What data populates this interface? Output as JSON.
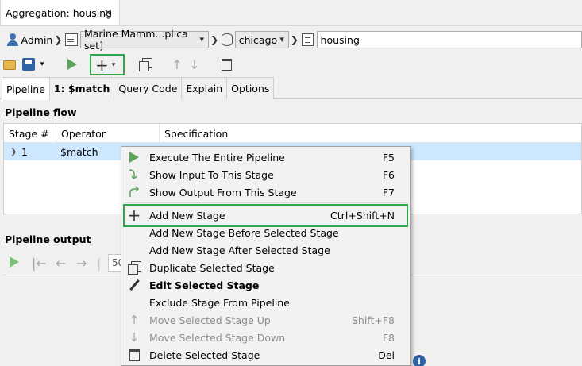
{
  "window": {
    "tab_title": "Aggregation: housing",
    "tab_close": "✕"
  },
  "breadcrumb": {
    "user": "Admin",
    "connection": "Marine Mamm...plica set]",
    "database": "chicago",
    "collection": "housing",
    "separator": "❯"
  },
  "toolbar": {
    "add_caret": "▾",
    "up_arrow": "↑",
    "down_arrow": "↓"
  },
  "tabs": [
    {
      "label": "Pipeline"
    },
    {
      "label": "1: $match"
    },
    {
      "label": "Query Code"
    },
    {
      "label": "Explain"
    },
    {
      "label": "Options"
    }
  ],
  "pipeline_flow": {
    "title": "Pipeline flow",
    "columns": [
      "Stage #",
      "Operator",
      "Specification"
    ],
    "rows": [
      {
        "expander": "❯",
        "stage": "1",
        "operator": "$match",
        "specification": ""
      }
    ]
  },
  "pipeline_output": {
    "title": "Pipeline output",
    "nav": {
      "first": "|←",
      "prev": "←",
      "next": "→",
      "sep": "|"
    },
    "page_size": "50"
  },
  "info_badge": "i",
  "context_menu": {
    "items": [
      {
        "label": "Execute The Entire Pipeline",
        "shortcut": "F5",
        "icon": "play-icon",
        "disabled": false
      },
      {
        "label": "Show Input To This Stage",
        "shortcut": "F6",
        "icon": "show-input-icon",
        "disabled": false
      },
      {
        "label": "Show Output From This Stage",
        "shortcut": "F7",
        "icon": "show-output-icon",
        "disabled": false
      },
      {
        "label": "Add New Stage",
        "shortcut": "Ctrl+Shift+N",
        "icon": "plus-icon",
        "disabled": false,
        "highlighted": true
      },
      {
        "label": "Add New Stage Before Selected Stage",
        "shortcut": "",
        "icon": "",
        "disabled": false
      },
      {
        "label": "Add New Stage After Selected Stage",
        "shortcut": "",
        "icon": "",
        "disabled": false
      },
      {
        "label": "Duplicate Selected Stage",
        "shortcut": "",
        "icon": "duplicate-icon",
        "disabled": false
      },
      {
        "label": "Edit Selected Stage",
        "shortcut": "",
        "icon": "pencil-icon",
        "disabled": false,
        "bold": true
      },
      {
        "label": "Exclude Stage From Pipeline",
        "shortcut": "",
        "icon": "",
        "disabled": false
      },
      {
        "label": "Move Selected Stage Up",
        "shortcut": "Shift+F8",
        "icon": "arrow-up-icon",
        "disabled": true
      },
      {
        "label": "Move Selected Stage Down",
        "shortcut": "F8",
        "icon": "arrow-down-icon",
        "disabled": true
      },
      {
        "label": "Delete Selected Stage",
        "shortcut": "Del",
        "icon": "trash-icon",
        "disabled": false
      }
    ],
    "plus_glyph": "+",
    "up_glyph": "↑",
    "down_glyph": "↓"
  },
  "colors": {
    "highlight_border": "#2ea84a",
    "selection_row": "#cde8ff",
    "play_green": "#5ba55b",
    "accent_blue": "#2f63a8"
  }
}
